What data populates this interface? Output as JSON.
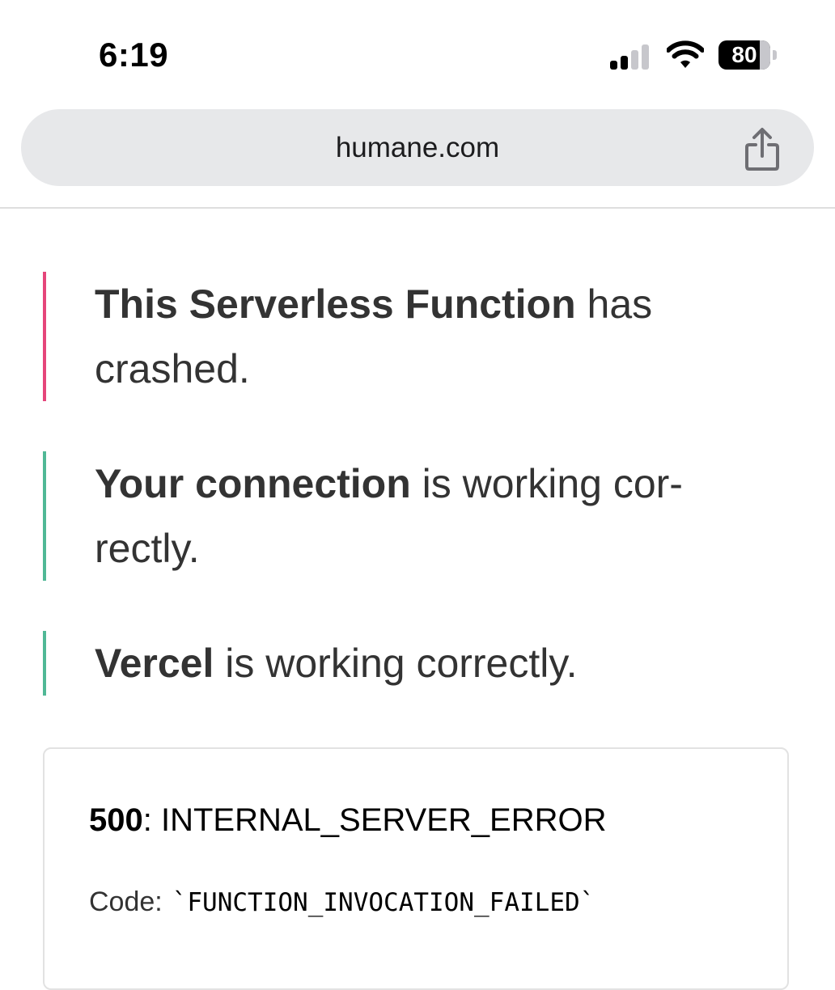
{
  "status_bar": {
    "time": "6:19",
    "battery_percent": "80",
    "battery_level": 0.8,
    "signal_bars_active": 2,
    "signal_bars_total": 4
  },
  "browser": {
    "url": "humane.com",
    "share_icon": "share-icon"
  },
  "notices": [
    {
      "bold": "This Serverless Function",
      "rest": " has crashed.",
      "color": "#e5457a"
    },
    {
      "bold": "Your connection",
      "rest": " is working cor-rectly.",
      "color": "#50b896"
    },
    {
      "bold": "Vercel",
      "rest": " is working correctly.",
      "color": "#50b896"
    }
  ],
  "error": {
    "status_code": "500",
    "status_text": ": INTERNAL_SERVER_ERROR",
    "code_label": "Code:",
    "code_value": "`FUNCTION_INVOCATION_FAILED`"
  }
}
